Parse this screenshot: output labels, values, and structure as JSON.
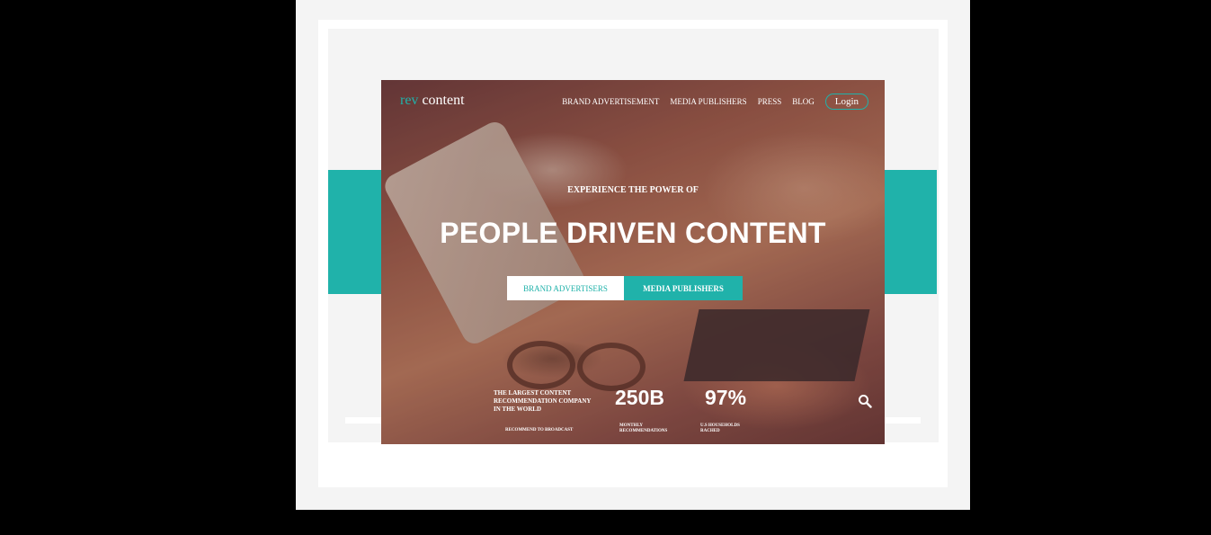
{
  "brand": {
    "logo_rev": "rev",
    "logo_content": "content"
  },
  "nav": {
    "items": [
      "BRAND ADVERTISEMENT",
      "MEDIA PUBLISHERS",
      "PRESS",
      "BLOG"
    ],
    "login": "Login"
  },
  "hero": {
    "kicker": "EXPERIENCE THE POWER OF",
    "headline": "PEOPLE DRIVEN CONTENT",
    "cta_brand": "BRAND ADVERTISERS",
    "cta_media": "MEDIA PUBLISHERS"
  },
  "stats": {
    "description": "THE LARGEST CONTENT RECOMMENDATION COMPANY IN THE WORLD",
    "recommend_link": "RECOMMEND TO BROADCAST",
    "monthly_value": "250B",
    "monthly_caption": "MONTHLY RECOMMENDATIONS",
    "households_value": "97%",
    "households_caption": "U.S HOUSEHOLDS RACHED"
  },
  "colors": {
    "accent": "#20b2aa",
    "frame": "#f4f4f4",
    "background": "#000000"
  },
  "icons": {
    "search": "search-icon"
  }
}
